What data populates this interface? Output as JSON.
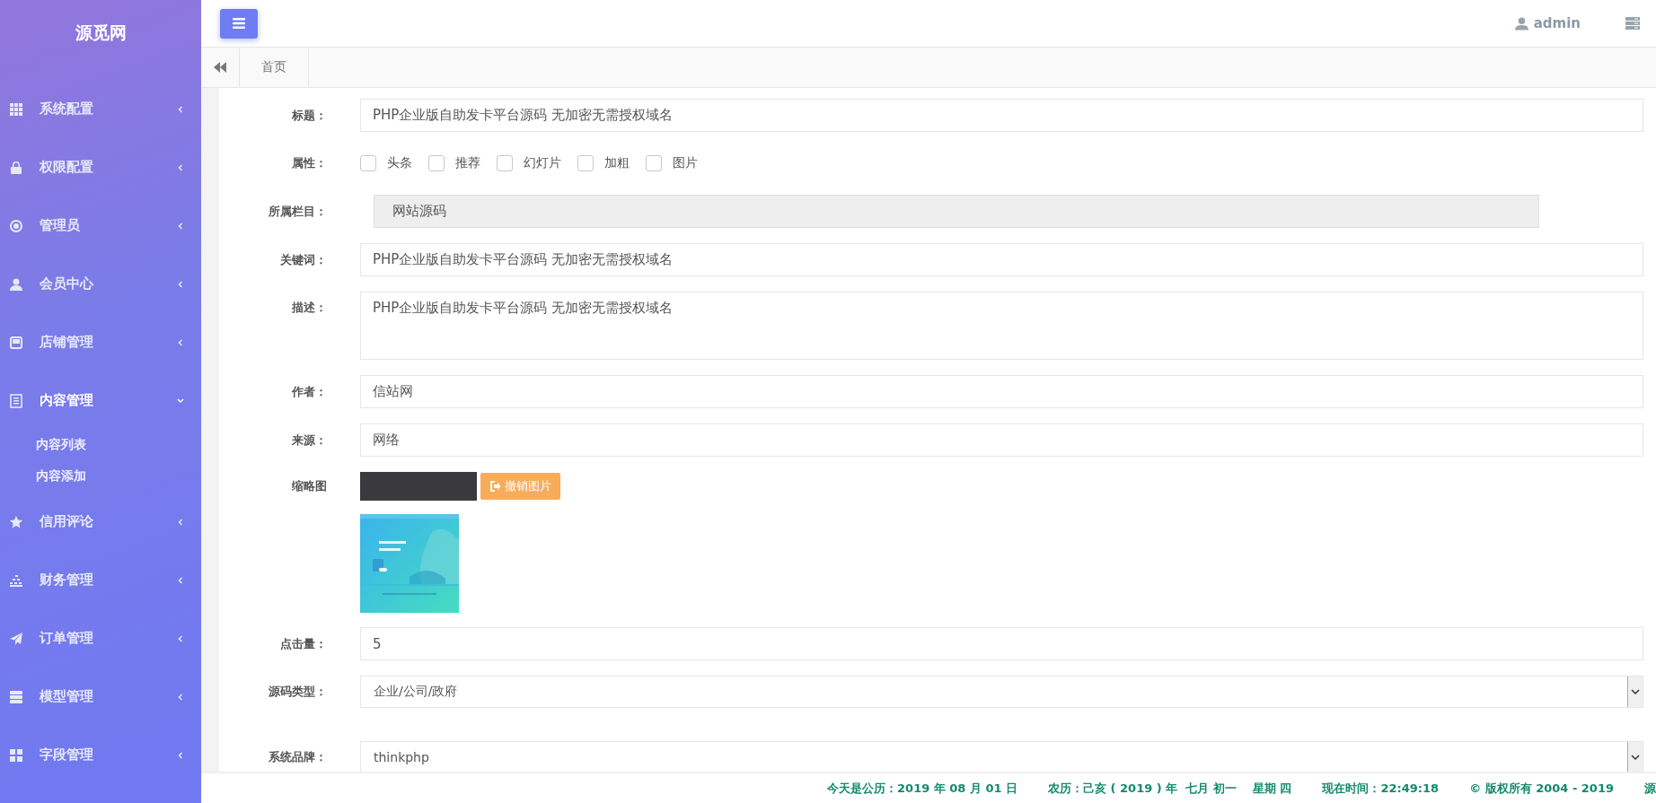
{
  "sidebar": {
    "logo": "源觅网",
    "items": [
      {
        "label": "系统配置",
        "expanded": false
      },
      {
        "label": "权限配置",
        "expanded": false
      },
      {
        "label": "管理员",
        "expanded": false
      },
      {
        "label": "会员中心",
        "expanded": false
      },
      {
        "label": "店铺管理",
        "expanded": false
      },
      {
        "label": "内容管理",
        "expanded": true,
        "children": [
          {
            "label": "内容列表"
          },
          {
            "label": "内容添加"
          }
        ]
      },
      {
        "label": "信用评论",
        "expanded": false
      },
      {
        "label": "财务管理",
        "expanded": false
      },
      {
        "label": "订单管理",
        "expanded": false
      },
      {
        "label": "模型管理",
        "expanded": false
      },
      {
        "label": "字段管理",
        "expanded": false
      }
    ]
  },
  "header": {
    "user": "admin"
  },
  "tabs": [
    {
      "label": "首页",
      "selected": true
    }
  ],
  "form": {
    "fields": [
      {
        "kind": "text",
        "label": "标题：",
        "value": "PHP企业版自助发卡平台源码 无加密无需授权域名"
      },
      {
        "kind": "checkboxes",
        "label": "属性：",
        "options": [
          {
            "label": "头条",
            "checked": false
          },
          {
            "label": "推荐",
            "checked": false
          },
          {
            "label": "幻灯片",
            "checked": false
          },
          {
            "label": "加粗",
            "checked": false
          },
          {
            "label": "图片",
            "checked": false
          }
        ]
      },
      {
        "kind": "readonly",
        "label": "所属栏目：",
        "value": "网站源码"
      },
      {
        "kind": "text",
        "label": "关键词：",
        "value": "PHP企业版自助发卡平台源码 无加密无需授权域名"
      },
      {
        "kind": "textarea",
        "label": "描述：",
        "value": "PHP企业版自助发卡平台源码 无加密无需授权域名"
      },
      {
        "kind": "text",
        "label": "作者：",
        "value": "信站网"
      },
      {
        "kind": "text",
        "label": "来源：",
        "value": "网络"
      },
      {
        "label": "缩略图",
        "button": "撤销图片"
      },
      {
        "kind": "text",
        "label": "点击量：",
        "value": "5"
      },
      {
        "kind": "select",
        "label": "源码类型：",
        "value": "企业/公司/政府"
      },
      {
        "kind": "select",
        "label": "系统品牌：",
        "value": "thinkphp"
      }
    ]
  },
  "footer": [
    "今天是公历：2019 年 08 月 01 日",
    "农历：己亥 ( 2019 ) 年  七月 初一    星期 四",
    "现在时间：22:49:18",
    "© 版权所有 2004 - 2019",
    "源"
  ]
}
